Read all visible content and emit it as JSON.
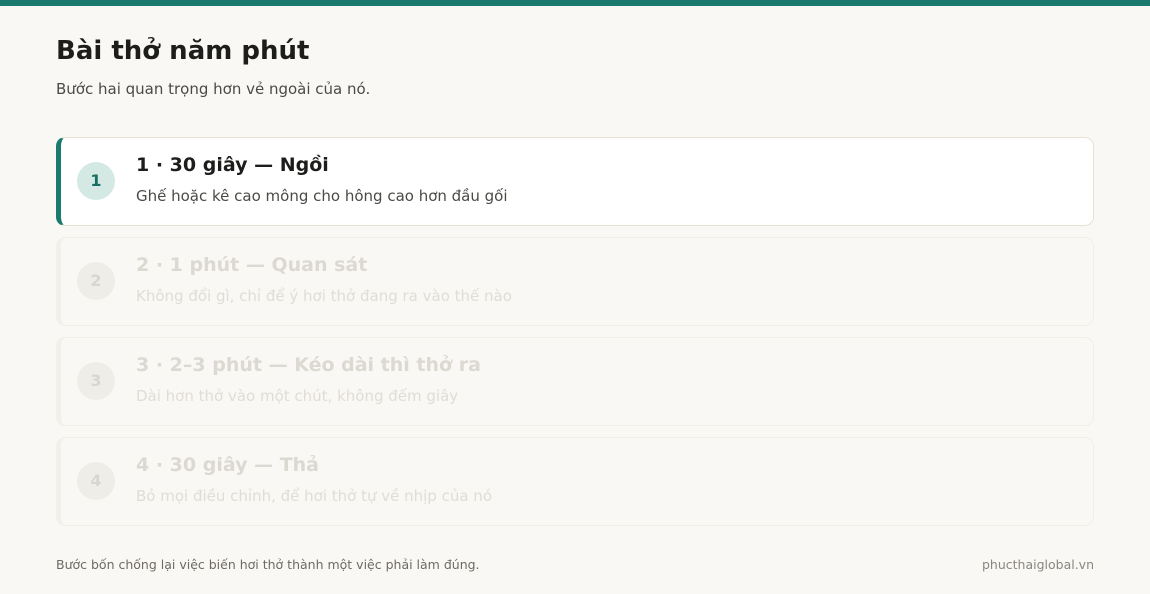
{
  "header": {
    "title": "Bài thở năm phút",
    "subtitle": "Bước hai quan trọng hơn vẻ ngoài của nó."
  },
  "steps": [
    {
      "number": "1",
      "title": "1 · 30 giây — Ngồi",
      "description": "Ghế hoặc kê cao mông cho hông cao hơn đầu gối",
      "state": "active"
    },
    {
      "number": "2",
      "title": "2 · 1 phút — Quan sát",
      "description": "Không đổi gì, chỉ để ý hơi thở đang ra vào thế nào",
      "state": "inactive"
    },
    {
      "number": "3",
      "title": "3 · 2–3 phút — Kéo dài thì thở ra",
      "description": "Dài hơn thở vào một chút, không đếm giây",
      "state": "inactive"
    },
    {
      "number": "4",
      "title": "4 · 30 giây — Thả",
      "description": "Bỏ mọi điều chỉnh, để hơi thở tự về nhịp của nó",
      "state": "inactive"
    }
  ],
  "footer": {
    "note": "Bước bốn chống lại việc biến hơi thở thành một việc phải làm đúng.",
    "site": "phucthaiglobal.vn"
  },
  "colors": {
    "accent": "#1a7a6e",
    "background": "#f9f8f5",
    "active_card": "#ffffff"
  }
}
